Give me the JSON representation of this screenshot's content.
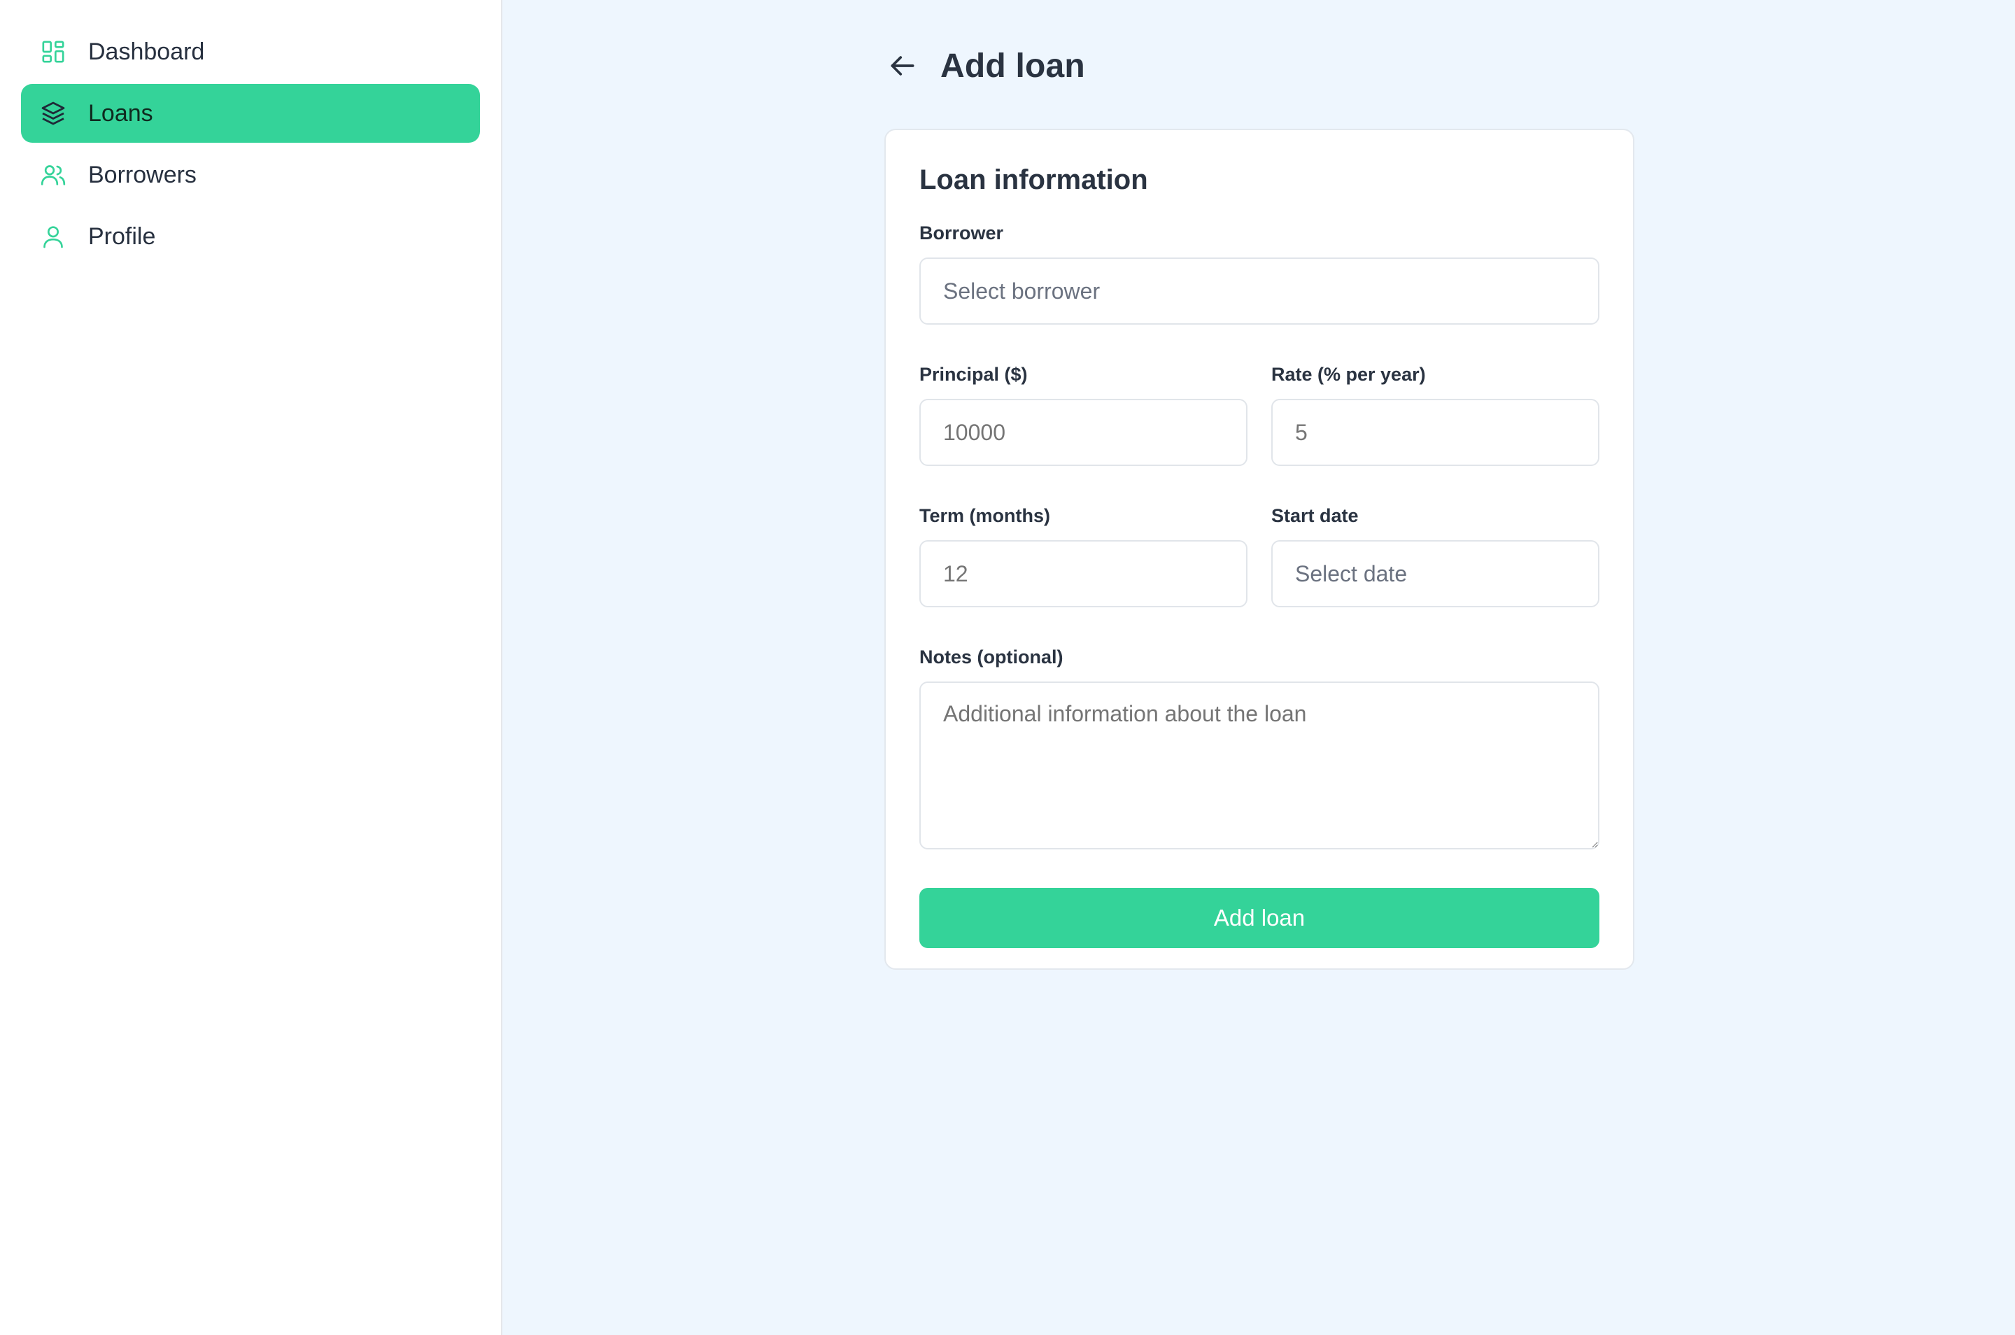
{
  "sidebar": {
    "items": [
      {
        "label": "Dashboard",
        "icon": "dashboard-grid-icon",
        "active": false
      },
      {
        "label": "Loans",
        "icon": "layers-icon",
        "active": true
      },
      {
        "label": "Borrowers",
        "icon": "users-icon",
        "active": false
      },
      {
        "label": "Profile",
        "icon": "user-icon",
        "active": false
      }
    ]
  },
  "header": {
    "title": "Add loan",
    "back_icon": "arrow-left-icon"
  },
  "form": {
    "title": "Loan information",
    "borrower": {
      "label": "Borrower",
      "placeholder": "Select borrower"
    },
    "principal": {
      "label": "Principal ($)",
      "placeholder": "10000"
    },
    "rate": {
      "label": "Rate (% per year)",
      "placeholder": "5"
    },
    "term": {
      "label": "Term (months)",
      "placeholder": "12"
    },
    "start_date": {
      "label": "Start date",
      "placeholder": "Select date"
    },
    "notes": {
      "label": "Notes (optional)",
      "placeholder": "Additional information about the loan"
    },
    "submit_label": "Add loan"
  },
  "colors": {
    "accent": "#34d399",
    "background": "#eef6fe",
    "text": "#2a3341"
  }
}
